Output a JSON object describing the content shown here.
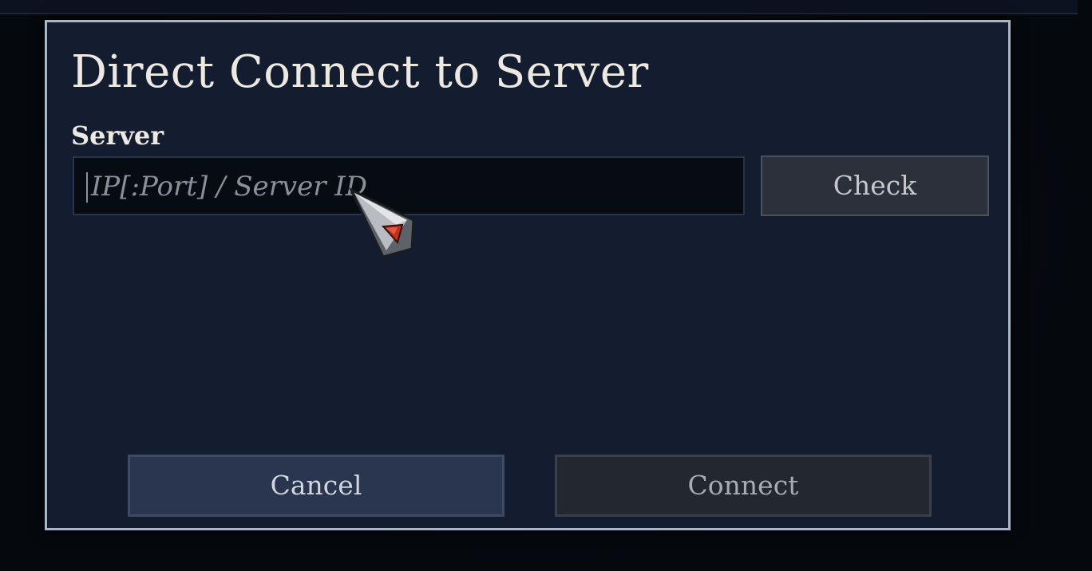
{
  "dialog": {
    "title": "Direct Connect to Server",
    "server_label": "Server",
    "server_input": {
      "value": "",
      "placeholder": "IP[:Port] / Server ID"
    },
    "check_label": "Check",
    "cancel_label": "Cancel",
    "connect_label": "Connect"
  },
  "icons": {
    "cursor": "game-pointer-icon"
  },
  "colors": {
    "dialog_background": "#141c2f",
    "dialog_border": "#a9b6c6",
    "input_background": "#070b12",
    "cancel_button": "#2a3550",
    "connect_button": "#23272f",
    "cursor_gem": "#c0301f"
  }
}
